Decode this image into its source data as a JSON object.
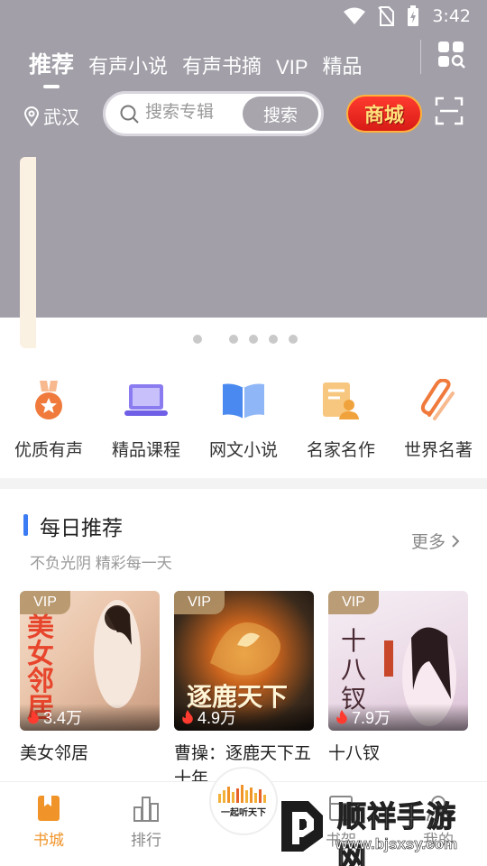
{
  "status_bar": {
    "time": "3:42"
  },
  "tabs": [
    {
      "label": "推荐",
      "active": true
    },
    {
      "label": "有声小说",
      "active": false
    },
    {
      "label": "有声书摘",
      "active": false
    },
    {
      "label": "VIP",
      "active": false
    },
    {
      "label": "精品",
      "active": false
    }
  ],
  "location": {
    "city": "武汉"
  },
  "search": {
    "placeholder": "搜索专辑",
    "button_label": "搜索"
  },
  "mall_button": {
    "label": "商城"
  },
  "banner": {
    "page_count": 5,
    "active_index": 0
  },
  "categories": [
    {
      "label": "优质有声",
      "icon": "medal-icon",
      "color": "#f07a3c"
    },
    {
      "label": "精品课程",
      "icon": "laptop-icon",
      "color": "#8a7cf0"
    },
    {
      "label": "网文小说",
      "icon": "open-book-icon",
      "color": "#4a8af0"
    },
    {
      "label": "名家名作",
      "icon": "author-profile-icon",
      "color": "#f0a23c"
    },
    {
      "label": "世界名著",
      "icon": "paperclip-icon",
      "color": "#f07a3c"
    }
  ],
  "daily_section": {
    "title": "每日推荐",
    "subtitle": "不负光阴 精彩每一天",
    "more_label": "更多"
  },
  "books": [
    {
      "title": "美女邻居",
      "badge": "VIP",
      "plays": "3.4万",
      "cover_text": "美女邻居"
    },
    {
      "title": "曹操：逐鹿天下五十年",
      "badge": "VIP",
      "plays": "4.9万",
      "cover_text": "逐鹿天下"
    },
    {
      "title": "十八钗",
      "badge": "VIP",
      "plays": "7.9万",
      "cover_text": "十八钗"
    }
  ],
  "bottom_nav": [
    {
      "label": "书城",
      "icon": "bookstore-icon",
      "active": true
    },
    {
      "label": "排行",
      "icon": "ranking-icon",
      "active": false
    },
    {
      "label": "书架",
      "icon": "bookshelf-icon",
      "active": false
    },
    {
      "label": "我的",
      "icon": "profile-icon",
      "active": false
    }
  ],
  "center_logo": {
    "text": "一起听天下"
  },
  "watermark": {
    "title": "顺祥手游网",
    "url": "www.bjsxsy.com"
  },
  "colors": {
    "accent": "#f0942a",
    "header_bg": "#a29fa8",
    "section_bar": "#3b7cf5"
  }
}
